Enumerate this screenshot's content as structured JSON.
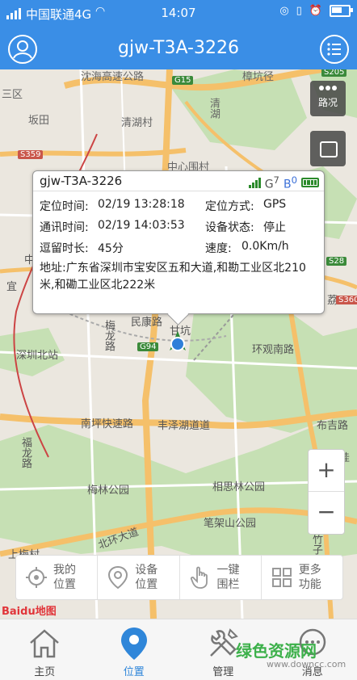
{
  "status_bar": {
    "carrier": "中国联通4G",
    "time": "14:07"
  },
  "header": {
    "title": "gjw-T3A-3226"
  },
  "map": {
    "labels": {
      "district": "三区",
      "mengxi": "沈海高速公路",
      "qingshuihe": "清湖村",
      "qinghu": "清湖",
      "kengcun": "坂田",
      "zhongxinweicun": "中心围村",
      "zhangkeng": "樟坑径",
      "ganxu": "甘坑",
      "shenzhenbei": "深圳北站",
      "minkang": "民康路",
      "meilong": "梅龙路",
      "huanzhen": "环观南路",
      "nanping": "南坪快速路",
      "fengze": "丰泽湖道道",
      "fulong": "福龙路",
      "meilinpark": "梅林公园",
      "xiangsilin": "相思林公园",
      "bijiashan": "笔架山公园",
      "beihuan": "北环大道",
      "shangmeicun": "上梅村",
      "zhuzhuang": "竹子林",
      "yi": "宜",
      "gui": "桂",
      "buji": "布吉路",
      "zhong": "中",
      "lilang": "荔"
    },
    "road_badges": {
      "g15": "G15",
      "s359": "S359",
      "g94": "G94",
      "s28": "S28",
      "s360": "S360",
      "s205": "S205"
    }
  },
  "traffic_button": {
    "label": "路况"
  },
  "popup": {
    "device": "gjw-T3A-3226",
    "gsm_g": "G",
    "gsm_g_sup": "7",
    "beidou_b": "B",
    "beidou_sup": "0",
    "locate_time_label": "定位时间:",
    "locate_time_value": "02/19 13:28:18",
    "locate_method_label": "定位方式:",
    "locate_method_value": "GPS",
    "comm_time_label": "通讯时间:",
    "comm_time_value": "02/19 14:03:53",
    "device_state_label": "设备状态:",
    "device_state_value": "停止",
    "stay_label": "逗留时长:",
    "stay_value": "45分",
    "speed_label": "速度:",
    "speed_value": "0.0Km/h",
    "address_label": "地址:",
    "address_value": "广东省深圳市宝安区五和大道,和勘工业区北210米,和磡工业区北222米"
  },
  "zoom": {
    "plus": "+",
    "minus": "−"
  },
  "actions": [
    {
      "line1": "我的",
      "line2": "位置",
      "icon": "crosshair-icon"
    },
    {
      "line1": "设备",
      "line2": "位置",
      "icon": "pin-icon"
    },
    {
      "line1": "一键",
      "line2": "围栏",
      "icon": "hand-icon"
    },
    {
      "line1": "更多",
      "line2": "功能",
      "icon": "grid-icon"
    }
  ],
  "logo": "Baidu地图",
  "watermark": {
    "line1": "绿色资源网",
    "line2": "www.downcc.com"
  },
  "tabs": [
    {
      "label": "主页",
      "icon": "home-icon"
    },
    {
      "label": "位置",
      "icon": "location-icon",
      "active": true
    },
    {
      "label": "管理",
      "icon": "tools-icon"
    },
    {
      "label": "消息",
      "icon": "message-icon"
    }
  ],
  "colors": {
    "primary": "#3a8ee6",
    "active_tab": "#2f86d9",
    "green_park": "#c6e0b4",
    "highway": "#f5c06a"
  }
}
